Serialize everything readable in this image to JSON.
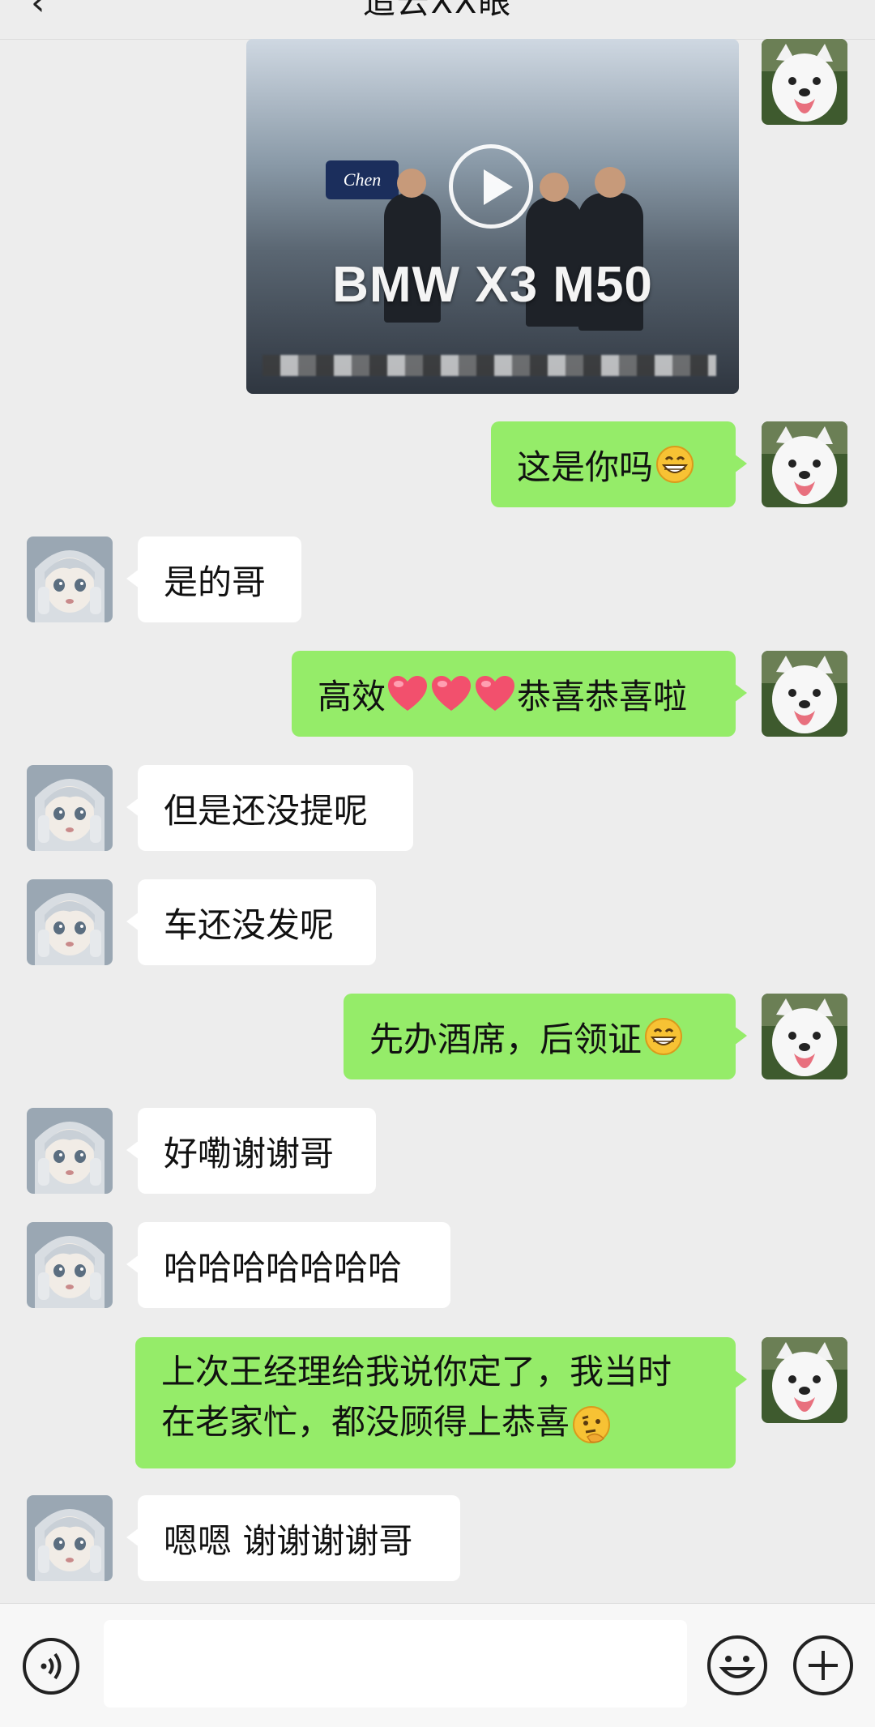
{
  "header": {
    "back_glyph": "‹",
    "title": "追云XX眼"
  },
  "video": {
    "caption": "BMW X3 M50",
    "sign_text": "Chen"
  },
  "messages": [
    {
      "side": "me",
      "text": "这是你吗",
      "emoji": "grin"
    },
    {
      "side": "them",
      "text": "是的哥"
    },
    {
      "side": "me",
      "text_before": "高效",
      "hearts": 3,
      "text_after": "恭喜恭喜啦"
    },
    {
      "side": "them",
      "text": "但是还没提呢"
    },
    {
      "side": "them",
      "text": "车还没发呢"
    },
    {
      "side": "me",
      "text": "先办酒席，后领证",
      "emoji": "grin"
    },
    {
      "side": "them",
      "text": "好嘞谢谢哥"
    },
    {
      "side": "them",
      "text": "哈哈哈哈哈哈哈"
    },
    {
      "side": "me",
      "line1": "上次王经理给我说你定了，我当时",
      "line2": "在老家忙，都没顾得上恭喜",
      "emoji": "thinking"
    },
    {
      "side": "them",
      "text": "嗯嗯 谢谢谢谢哥"
    }
  ],
  "input": {
    "value": ""
  },
  "icons": {
    "voice": "voice-icon",
    "emoji": "emoji-icon",
    "plus": "plus-icon",
    "avatar_me": "samoyed-dog-avatar",
    "avatar_them": "anime-girl-avatar"
  },
  "colors": {
    "my_bubble": "#95ec69",
    "their_bubble": "#ffffff",
    "background": "#ededed"
  }
}
